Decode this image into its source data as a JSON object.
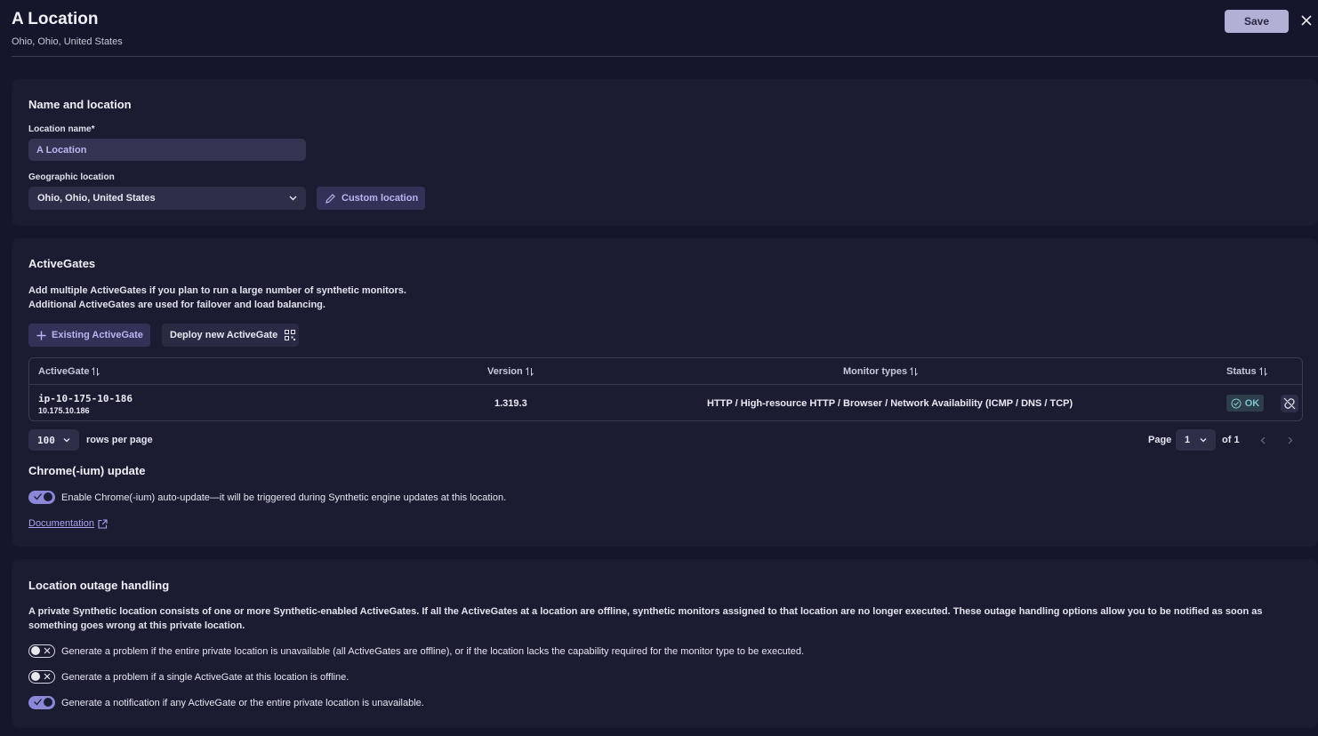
{
  "header": {
    "title": "A Location",
    "subtitle": "Ohio, Ohio, United States",
    "save_label": "Save"
  },
  "name_location": {
    "title": "Name and location",
    "name_label": "Location name*",
    "name_value": "A Location",
    "geo_label": "Geographic location",
    "geo_value": "Ohio, Ohio, United States",
    "custom_location_label": "Custom location"
  },
  "activegates": {
    "title": "ActiveGates",
    "description_line1": "Add multiple ActiveGates if you plan to run a large number of synthetic monitors.",
    "description_line2": "Additional ActiveGates are used for failover and load balancing.",
    "existing_label": "Existing ActiveGate",
    "deploy_label": "Deploy new ActiveGate",
    "table": {
      "columns": [
        "ActiveGate",
        "Version",
        "Monitor types",
        "Status"
      ],
      "rows": [
        {
          "name": "ip-10-175-10-186",
          "ip": "10.175.10.186",
          "version": "1.319.3",
          "monitor_types": "HTTP / High-resource HTTP / Browser / Network Availability (ICMP / DNS / TCP)",
          "status": "OK"
        }
      ]
    },
    "pagination": {
      "rows_per_page_value": "100",
      "rows_per_page_label": "rows per page",
      "page_label": "Page",
      "page_value": "1",
      "of_label": "of 1"
    }
  },
  "chrome": {
    "title": "Chrome(-ium) update",
    "toggle_label": "Enable Chrome(-ium) auto-update—it will be triggered during Synthetic engine updates at this location.",
    "toggle_on": true,
    "doc_link": "Documentation"
  },
  "outage": {
    "title": "Location outage handling",
    "description": "A private Synthetic location consists of one or more Synthetic-enabled ActiveGates. If all the ActiveGates at a location are offline, synthetic monitors assigned to that location are no longer executed. These outage handling options allow you to be notified as soon as something goes wrong at this private location.",
    "options": [
      {
        "label": "Generate a problem if the entire private location is unavailable (all ActiveGates are offline), or if the location lacks the capability required for the monitor type to be executed.",
        "on": false
      },
      {
        "label": "Generate a problem if a single ActiveGate at this location is offline.",
        "on": false
      },
      {
        "label": "Generate a notification if any ActiveGate or the entire private location is unavailable.",
        "on": true
      }
    ]
  },
  "colors": {
    "background": "#15152b",
    "card": "#1b1b32",
    "accent": "#b8b6f0",
    "save_button": "#b3b0d6",
    "status_ok": "#7ec4cf"
  },
  "icons": [
    "close-icon",
    "chevron-down-icon",
    "pencil-icon",
    "plus-icon",
    "qr-code-icon",
    "sort-icon",
    "check-circle-icon",
    "unlink-icon",
    "chevron-left-icon",
    "chevron-right-icon",
    "external-link-icon",
    "check-icon",
    "x-icon"
  ]
}
